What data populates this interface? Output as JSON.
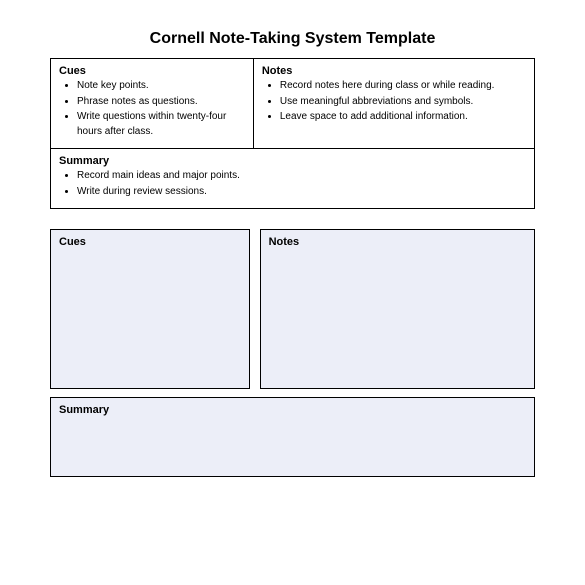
{
  "title": "Cornell Note-Taking System Template",
  "example": {
    "cues": {
      "heading": "Cues",
      "items": [
        "Note key points.",
        "Phrase notes as questions.",
        "Write questions within twenty-four hours after class."
      ]
    },
    "notes": {
      "heading": "Notes",
      "items": [
        "Record notes here during class or while reading.",
        "Use meaningful abbreviations and symbols.",
        "Leave space to add additional information."
      ]
    },
    "summary": {
      "heading": "Summary",
      "items": [
        "Record main ideas and major points.",
        "Write during review sessions."
      ]
    }
  },
  "template": {
    "cues_heading": "Cues",
    "notes_heading": "Notes",
    "summary_heading": "Summary"
  }
}
